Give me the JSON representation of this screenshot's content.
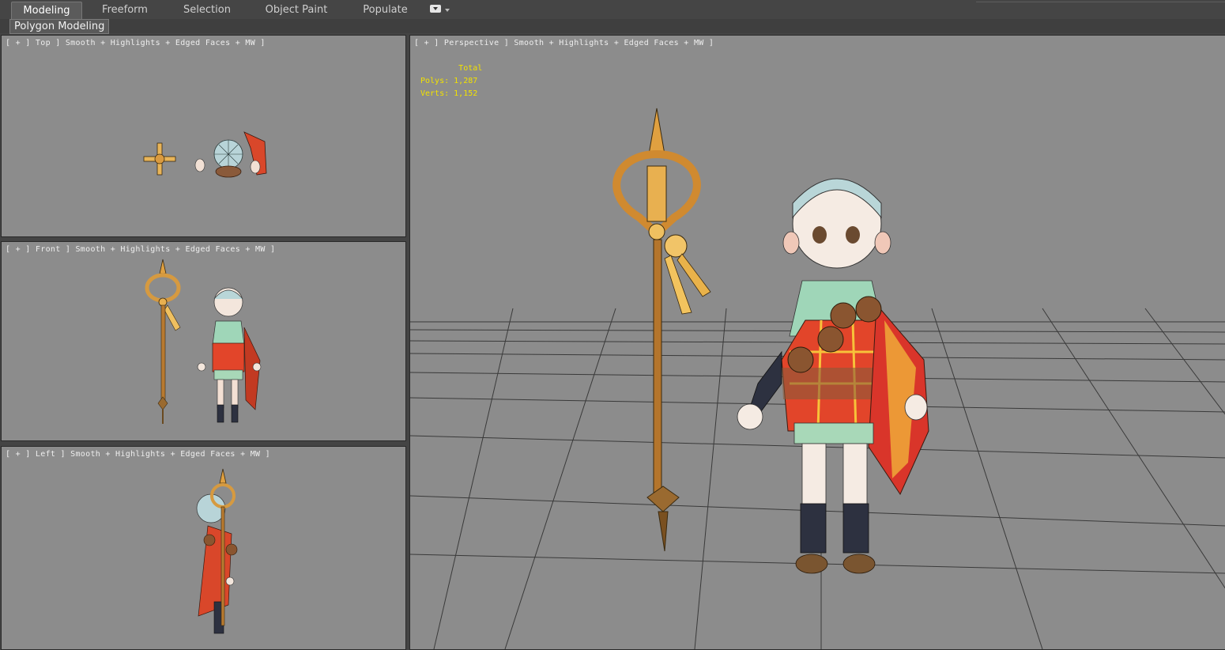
{
  "ribbon": {
    "tabs": [
      {
        "label": "Modeling",
        "active": true
      },
      {
        "label": "Freeform",
        "active": false
      },
      {
        "label": "Selection",
        "active": false
      },
      {
        "label": "Object Paint",
        "active": false
      },
      {
        "label": "Populate",
        "active": false
      }
    ],
    "panel_label": "Polygon Modeling"
  },
  "viewports": {
    "top": {
      "label": "[ + ] Top ] Smooth + Highlights + Edged Faces + MW ]"
    },
    "front": {
      "label": "[ + ] Front ] Smooth + Highlights + Edged Faces + MW ]"
    },
    "left": {
      "label": "[ + ] Left ] Smooth + Highlights + Edged Faces + MW ]"
    },
    "perspective": {
      "label": "[ + ] Perspective ] Smooth + Highlights + Edged Faces + MW ]",
      "stats": {
        "title": "Total",
        "polys_label": "Polys:",
        "polys_value": "1,287",
        "verts_label": "Verts:",
        "verts_value": "1,152"
      }
    }
  },
  "colors": {
    "viewport_bg": "#8c8c8c",
    "stats_text": "#f2e200",
    "active_tab": "#5b5b5b"
  }
}
